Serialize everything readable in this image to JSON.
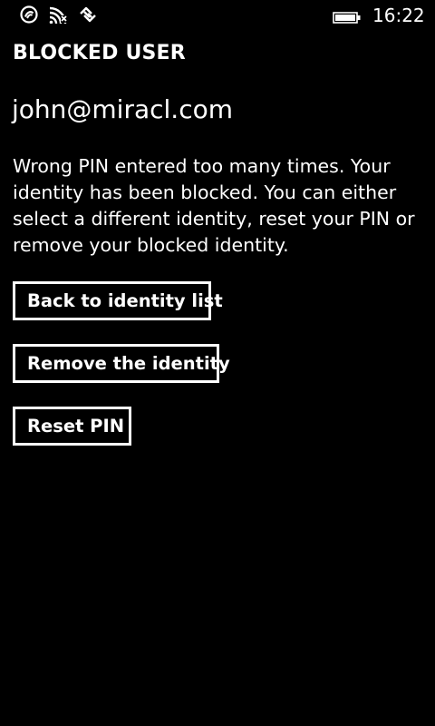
{
  "status_bar": {
    "icons": [
      "nfc-icon",
      "wifi-icon",
      "data-sync-icon",
      "battery-icon"
    ],
    "time": "16:22"
  },
  "page": {
    "title": "BLOCKED USER",
    "identity": "john@miracl.com",
    "message": "Wrong PIN entered too many times. Your identity has been blocked. You can either select a different identity, reset your PIN or remove your blocked identity."
  },
  "actions": {
    "back_label": "Back to identity list",
    "remove_label": "Remove the identity",
    "reset_label": "Reset PIN"
  },
  "colors": {
    "background": "#000000",
    "foreground": "#ffffff"
  }
}
